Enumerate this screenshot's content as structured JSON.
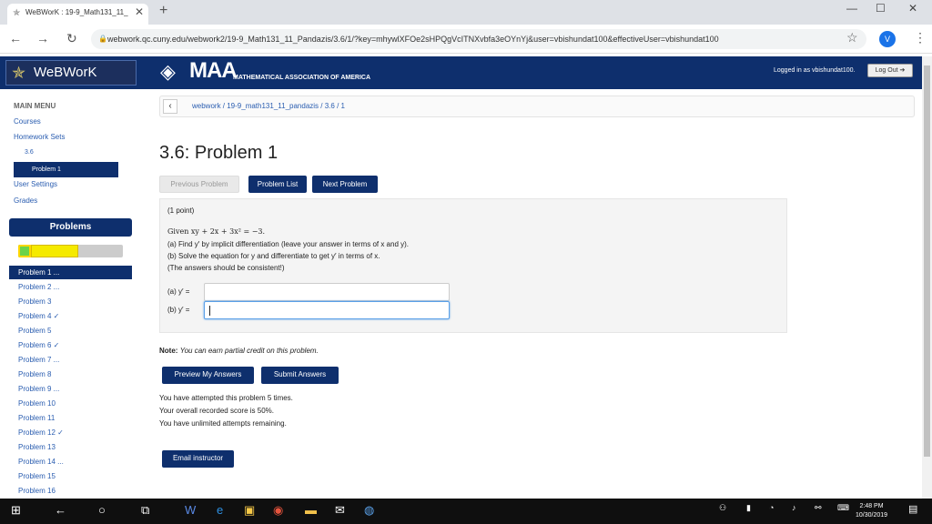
{
  "browser": {
    "tab_title": "WeBWorK : 19-9_Math131_11_",
    "tab_close": "✕",
    "new_tab": "+",
    "url": "webwork.qc.cuny.edu/webwork2/19-9_Math131_11_Pandazis/3.6/1/?key=mhywlXFOe2sHPQgVcITNXvbfa3eOYnYj&user=vbishundat100&effectiveUser=vbishundat100",
    "avatar_letter": "V"
  },
  "header": {
    "logo": "WeBWorK",
    "maa_big": "MAA",
    "maa_small": "MATHEMATICAL ASSOCIATION OF AMERICA",
    "logged_in": "Logged in as vbishundat100.",
    "logout": "Log Out"
  },
  "sidebar": {
    "main_menu": "MAIN MENU",
    "courses": "Courses",
    "homework_sets": "Homework Sets",
    "set": "3.6",
    "problem_selected": "Problem 1",
    "user_settings": "User Settings",
    "grades": "Grades",
    "problems_header": "Problems",
    "progress_correct_fraction": 0.12,
    "progress_partial_fraction": 0.45,
    "problems": [
      "Problem 1 ...",
      "Problem 2 ...",
      "Problem 3",
      "Problem 4 ✓",
      "Problem 5",
      "Problem 6 ✓",
      "Problem 7 ...",
      "Problem 8",
      "Problem 9 ...",
      "Problem 10",
      "Problem 11",
      "Problem 12 ✓",
      "Problem 13",
      "Problem 14 ...",
      "Problem 15",
      "Problem 16"
    ]
  },
  "main": {
    "breadcrumb": "webwork / 19-9_math131_11_pandazis / 3.6 / 1",
    "title": "3.6: Problem 1",
    "prev_button": "Previous Problem",
    "list_button": "Problem List",
    "next_button": "Next Problem",
    "points": "(1 point)",
    "given": "Given xy + 2x + 3x² = −3.",
    "part_a": "(a) Find y′ by implicit differentiation (leave your answer in terms of x and y).",
    "part_b": "(b) Solve the equation for y and differentiate to get y′ in terms of x.",
    "consistent": "(The answers should be consistent!)",
    "answer_a_label": "(a) y′ =",
    "answer_b_label": "(b) y′ =",
    "answer_a_value": "",
    "answer_b_value": "",
    "note_label": "Note:",
    "note_text": "You can earn partial credit on this problem.",
    "preview_button": "Preview My Answers",
    "submit_button": "Submit Answers",
    "attempts": "You have attempted this problem 5 times.",
    "score": "Your overall recorded score is 50%.",
    "remaining": "You have unlimited attempts remaining.",
    "email_button": "Email instructor"
  },
  "taskbar": {
    "time": "2:48 PM",
    "date": "10/30/2019"
  }
}
